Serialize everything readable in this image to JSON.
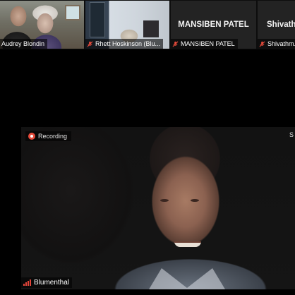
{
  "participants": [
    {
      "name": "Audrey Blondin",
      "muted": false,
      "video": true
    },
    {
      "name": "Rhett Hoskinson (Blu...",
      "muted": true,
      "video": true
    },
    {
      "name": "MANSIBEN PATEL",
      "display_name": "MANSIBEN PATEL",
      "muted": true,
      "video": false
    },
    {
      "name": "Shivathm...",
      "display_name": "Shivath",
      "muted": true,
      "video": false
    }
  ],
  "recording": {
    "label": "Recording",
    "indicator_color": "#e64b3b"
  },
  "share_edge": {
    "label": "S"
  },
  "active_speaker": {
    "name": "Blumenthal",
    "audio_icon": "audio-level-icon"
  },
  "colors": {
    "muted_icon": "#e64b3b",
    "audio_level": "#e2453a",
    "background": "#000000"
  }
}
